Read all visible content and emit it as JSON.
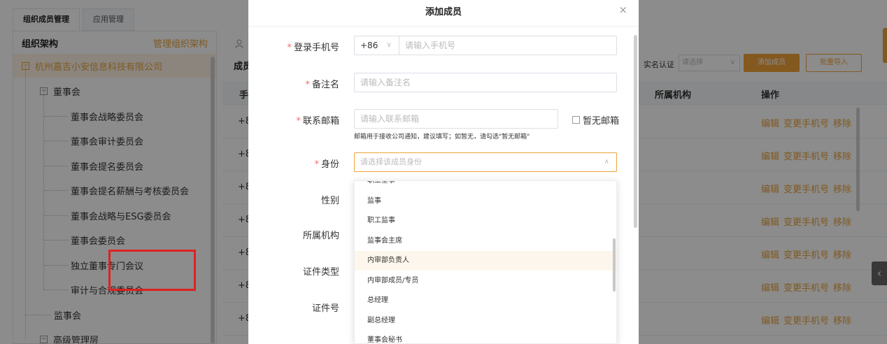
{
  "tabs": [
    "组织成员管理",
    "应用管理"
  ],
  "left": {
    "title": "组织架构",
    "manage": "管理组织架构",
    "tree": [
      {
        "label": "杭州嘉吉小安信息科技有限公司",
        "toggle": "−"
      },
      {
        "label": "董事会",
        "toggle": "−"
      },
      {
        "label": "董事会战略委员会"
      },
      {
        "label": "董事会审计委员会"
      },
      {
        "label": "董事会提名委员会"
      },
      {
        "label": "董事会提名薪酬与考核委员会"
      },
      {
        "label": "董事会战略与ESG委员会"
      },
      {
        "label": "董事会委员会"
      },
      {
        "label": "独立董事专门会议"
      },
      {
        "label": "审计与合规委员会"
      },
      {
        "label": "监事会"
      },
      {
        "label": "高级管理层",
        "toggle": "−"
      }
    ]
  },
  "right": {
    "members_label": "成员",
    "realname_label": "实名认证",
    "realname_placeholder": "请选择",
    "add_button": "添加成员",
    "batch_button": "批量导入",
    "col_first": "手",
    "col_org": "所属机构",
    "col_ops": "操作",
    "rows": [
      "+8",
      "+8",
      "+8",
      "+8",
      "+8",
      "+8",
      "+8"
    ],
    "ops": [
      "编辑",
      "变更手机号",
      "移除"
    ]
  },
  "modal": {
    "title": "添加成员",
    "close": "×",
    "phone_label": "登录手机号",
    "phone_prefix": "+86",
    "phone_placeholder": "请输入手机号",
    "remark_label": "备注名",
    "remark_placeholder": "请输入备注名",
    "email_label": "联系邮箱",
    "email_placeholder": "请输入联系邮箱",
    "no_email": "暂无邮箱",
    "email_hint": "邮箱用于接收公司通知，建议填写；如暂无，请勾选\"暂无邮箱\"",
    "identity_label": "身份",
    "identity_placeholder": "请选择该成员身份",
    "gender_label": "性别",
    "org_label": "所属机构",
    "cert_type_label": "证件类型",
    "cert_no_label": "证件号",
    "identity_options": [
      "职工董事",
      "监事",
      "职工监事",
      "监事会主席",
      "内审部负责人",
      "内审部成员/专员",
      "总经理",
      "副总经理",
      "董事会秘书"
    ]
  },
  "colors": {
    "accent": "#f0a33a",
    "highlight": "#e02020"
  }
}
